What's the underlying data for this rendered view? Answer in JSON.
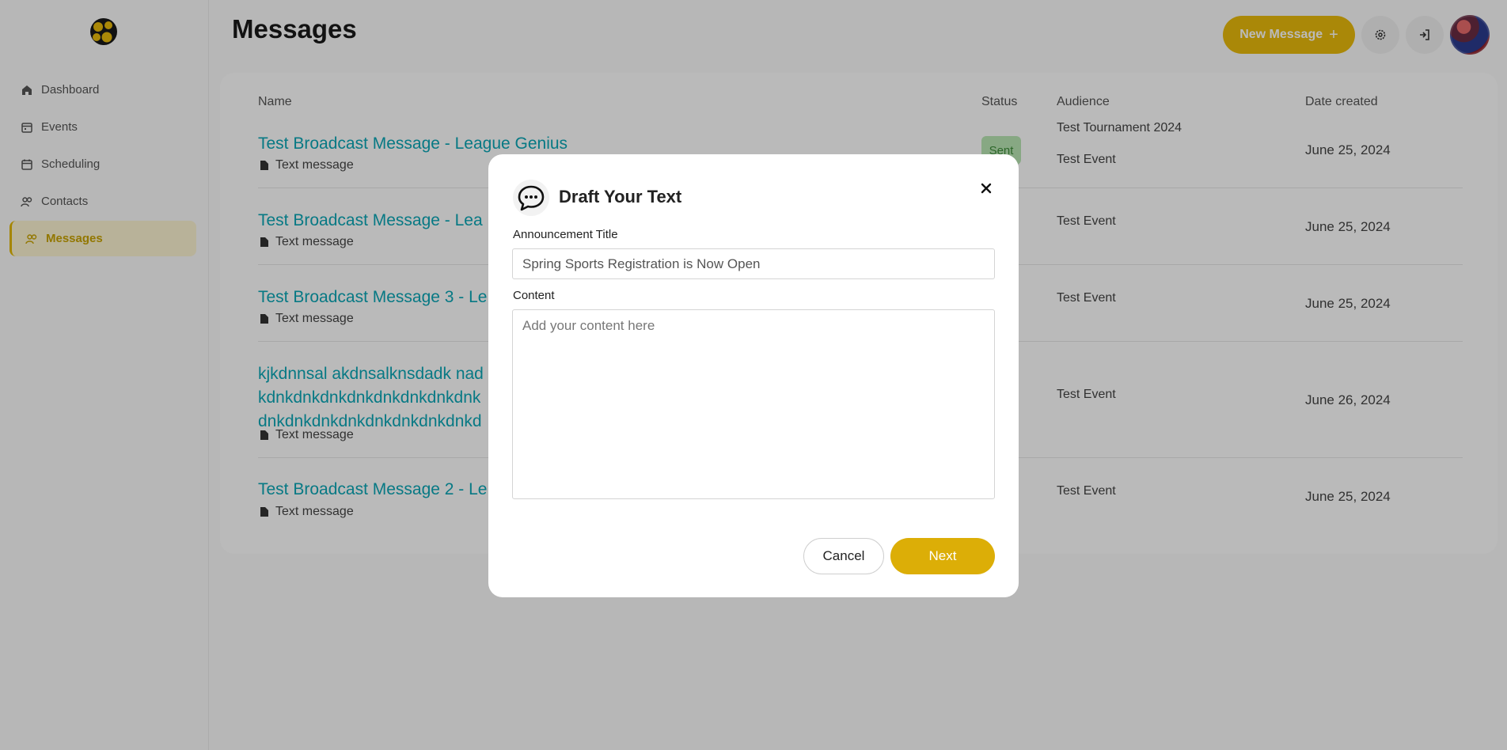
{
  "sidebar": {
    "items": [
      {
        "label": "Dashboard",
        "icon": "home-icon"
      },
      {
        "label": "Events",
        "icon": "calendar-icon"
      },
      {
        "label": "Scheduling",
        "icon": "calendar-check-icon"
      },
      {
        "label": "Contacts",
        "icon": "users-icon"
      },
      {
        "label": "Messages",
        "icon": "users-icon",
        "active": true
      }
    ]
  },
  "header": {
    "title": "Messages",
    "new_message_label": "New Message",
    "settings_icon": "gear-icon",
    "logout_icon": "logout-icon"
  },
  "table": {
    "columns": [
      "Name",
      "Status",
      "Audience",
      "Date created"
    ],
    "rows": [
      {
        "name": "Test Broadcast Message - League Genius",
        "type": "Text message",
        "status": "Sent",
        "audience": [
          "Test Tournament 2024",
          "Test Event"
        ],
        "date": "June 25, 2024"
      },
      {
        "name": "Test Broadcast Message - Lea",
        "type": "Text message",
        "status": "",
        "audience": [
          "Test Event"
        ],
        "date": "June 25, 2024"
      },
      {
        "name": "Test Broadcast Message 3 - Le",
        "type": "Text message",
        "status": "",
        "audience": [
          "Test Event"
        ],
        "date": "June 25, 2024"
      },
      {
        "name": "kjkdnnsal akdnsalknsdadk nad",
        "name2": "kdnkdnkdnkdnkdnkdnkdnkdnk",
        "name3": "dnkdnkdnkdnkdnkdnkdnkdnkd",
        "type": "Text message",
        "status": "",
        "audience": [
          "Test Event"
        ],
        "date": "June 26, 2024"
      },
      {
        "name": "Test Broadcast Message 2 - Le",
        "type": "Text message",
        "status": "",
        "audience": [
          "Test Event"
        ],
        "date": "June 25, 2024"
      }
    ]
  },
  "modal": {
    "title": "Draft Your Text",
    "announcement_label": "Announcement Title",
    "announcement_value": "Spring Sports Registration is Now Open",
    "content_label": "Content",
    "content_placeholder": "Add your content here",
    "cancel_label": "Cancel",
    "next_label": "Next"
  },
  "colors": {
    "accent": "#e9bb0c",
    "link": "#0aa6b6",
    "status_sent_bg": "#b9e6b4"
  }
}
